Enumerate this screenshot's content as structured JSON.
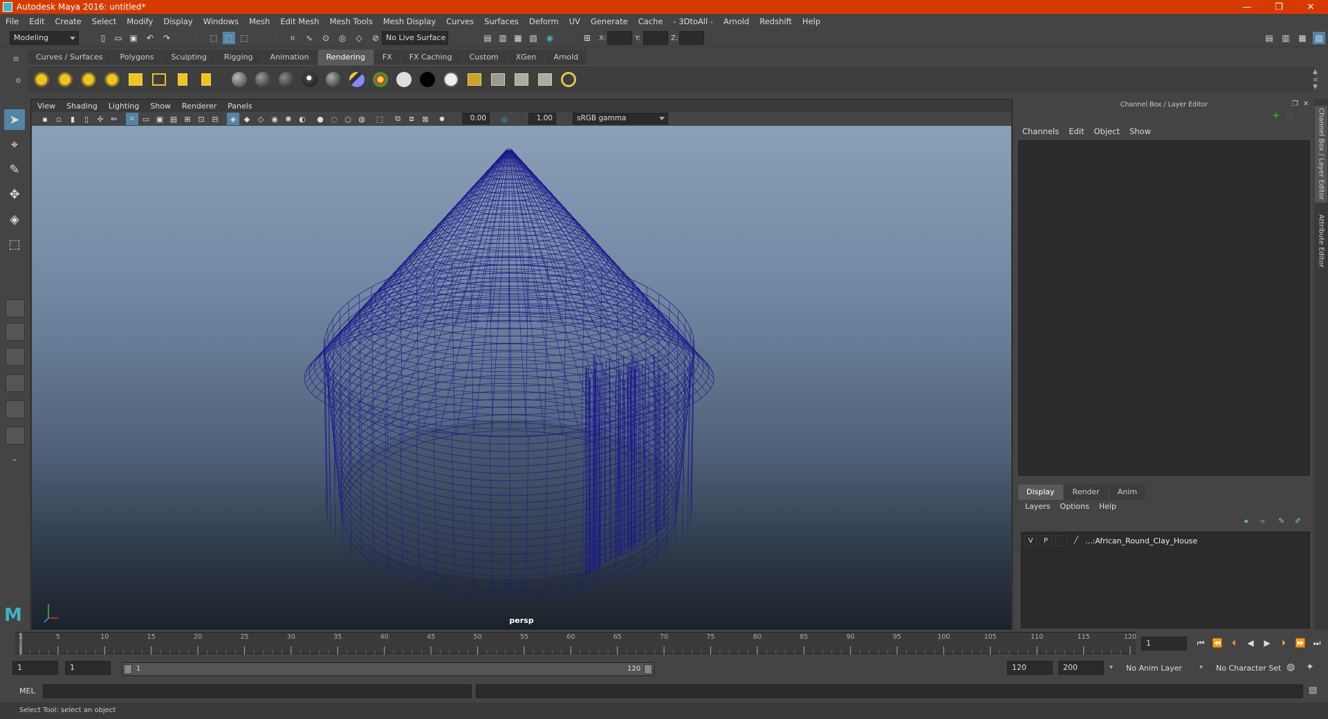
{
  "window": {
    "title": "Autodesk Maya 2016: untitled*",
    "minimize": "—",
    "maximize": "❐",
    "close": "✕"
  },
  "menu": [
    "File",
    "Edit",
    "Create",
    "Select",
    "Modify",
    "Display",
    "Windows",
    "Mesh",
    "Edit Mesh",
    "Mesh Tools",
    "Mesh Display",
    "Curves",
    "Surfaces",
    "Deform",
    "UV",
    "Generate",
    "Cache",
    "- 3DtoAll -",
    "Arnold",
    "Redshift",
    "Help"
  ],
  "status": {
    "mode": "Modeling",
    "live_surface": "No Live Surface",
    "x_label": "X:",
    "y_label": "Y:",
    "z_label": "Z:"
  },
  "shelf_tabs": [
    {
      "label": "Curves / Surfaces"
    },
    {
      "label": "Polygons"
    },
    {
      "label": "Sculpting"
    },
    {
      "label": "Rigging"
    },
    {
      "label": "Animation"
    },
    {
      "label": "Rendering",
      "active": true
    },
    {
      "label": "FX"
    },
    {
      "label": "FX Caching"
    },
    {
      "label": "Custom"
    },
    {
      "label": "XGen"
    },
    {
      "label": "Arnold"
    }
  ],
  "viewport": {
    "menu": [
      "View",
      "Shading",
      "Lighting",
      "Show",
      "Renderer",
      "Panels"
    ],
    "exposure": "0.00",
    "gamma": "1.00",
    "color_space": "sRGB gamma",
    "camera_label": "persp",
    "wire_color": "#1a1a8c"
  },
  "channel_box": {
    "title": "Channel Box / Layer Editor",
    "menu": [
      "Channels",
      "Edit",
      "Object",
      "Show"
    ],
    "side_tab_1": "Channel Box / Layer Editor",
    "side_tab_2": "Attribute Editor"
  },
  "layer_editor": {
    "tabs": [
      {
        "label": "Display",
        "active": true
      },
      {
        "label": "Render"
      },
      {
        "label": "Anim"
      }
    ],
    "menu": [
      "Layers",
      "Options",
      "Help"
    ],
    "layer": {
      "v": "V",
      "p": "P",
      "name": "...:African_Round_Clay_House"
    }
  },
  "timeline": {
    "labels": [
      "1",
      "5",
      "10",
      "15",
      "20",
      "25",
      "30",
      "35",
      "40",
      "45",
      "50",
      "55",
      "60",
      "65",
      "70",
      "75",
      "80",
      "85",
      "90",
      "95",
      "100",
      "105",
      "110",
      "115",
      "120"
    ],
    "current_frame": "1"
  },
  "range": {
    "start": "1",
    "anim_start": "1",
    "range_start": "1",
    "range_end": "120",
    "anim_end": "120",
    "end": "200",
    "anim_layer": "No Anim Layer",
    "char_set": "No Character Set"
  },
  "cmd": {
    "label": "MEL"
  },
  "help_line": "Select Tool: select an object",
  "accent": "#5285a6",
  "title_color": "#d83b01"
}
